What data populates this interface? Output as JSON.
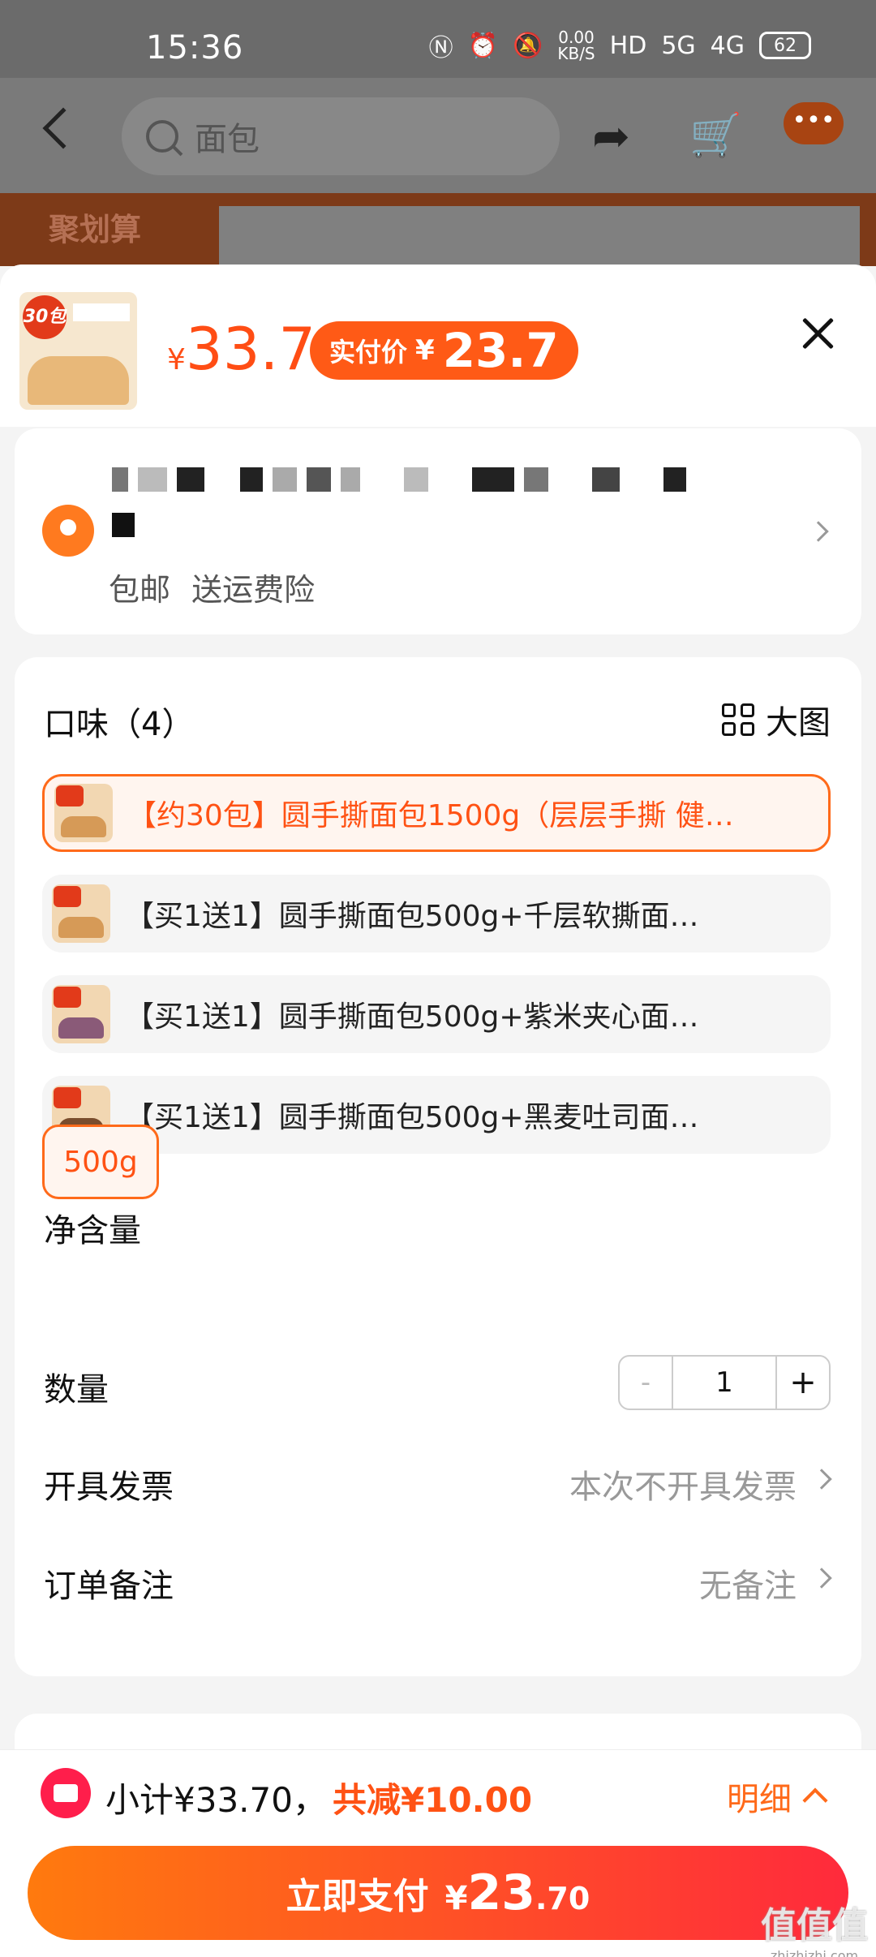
{
  "status_bar": {
    "time": "15:36",
    "net_speed": "0.00",
    "net_unit": "KB/S",
    "hd": "HD",
    "sig1": "5G",
    "sig2": "4G",
    "battery": "62"
  },
  "background_page": {
    "search_placeholder": "面包",
    "banner_text": "聚划算"
  },
  "sheet": {
    "thumb_badge": "30包",
    "price_symbol": "¥",
    "price": "33.7",
    "actual_label": "实付价",
    "actual_symbol": "¥",
    "actual_price": "23.7"
  },
  "address": {
    "shipping": [
      "包邮",
      "送运费险"
    ]
  },
  "options": {
    "flavor_title": "口味（4）",
    "big_image_label": "大图",
    "flavors": [
      "【约30包】圆手撕面包1500g（层层手撕 健…",
      "【买1送1】圆手撕面包500g+千层软撕面…",
      "【买1送1】圆手撕面包500g+紫米夹心面…",
      "【买1送1】圆手撕面包500g+黑麦吐司面…"
    ],
    "selected_index": 0,
    "net_title": "净含量",
    "net_value": "500g",
    "qty_title": "数量",
    "qty_minus": "-",
    "qty_value": "1",
    "qty_plus": "+",
    "invoice_title": "开具发票",
    "invoice_value": "本次不开具发票",
    "remark_title": "订单备注",
    "remark_value": "无备注"
  },
  "bottom_bar": {
    "subtotal": "小计¥33.70，",
    "discount": "共减¥10.00",
    "detail": "明细",
    "pay_label": "立即支付",
    "pay_symbol": "¥",
    "pay_int": "23",
    "pay_dec": ".70"
  },
  "watermark": {
    "main": "值值值",
    "sub": "zhizhizhi.com"
  }
}
